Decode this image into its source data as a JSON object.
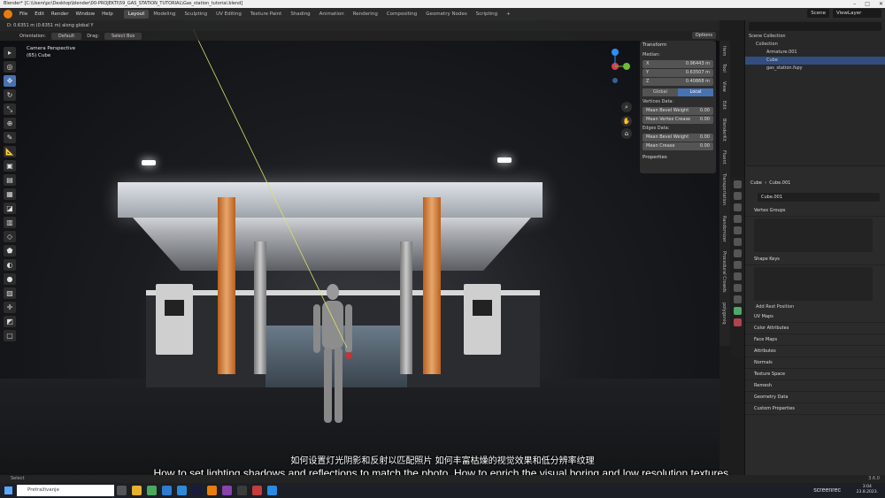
{
  "window": {
    "title": "Blender* [C:\\Users\\pc\\Desktop\\blender\\00-PROJEKTI\\59_GAS_STATION_TUTORIAL\\Gas_station_tutorial.blend]",
    "controls": [
      "–",
      "□",
      "✕"
    ]
  },
  "menu": [
    "File",
    "Edit",
    "Render",
    "Window",
    "Help"
  ],
  "workspaces": [
    "Layout",
    "Modeling",
    "Sculpting",
    "UV Editing",
    "Texture Paint",
    "Shading",
    "Animation",
    "Rendering",
    "Compositing",
    "Geometry Nodes",
    "Scripting",
    "+"
  ],
  "top_right": {
    "scene": "Scene",
    "view_layer": "ViewLayer"
  },
  "viewport": {
    "status": "D: 0.6351 m (0.6351 m) along global Y",
    "orientation_label": "Orientation:",
    "orientation_value": "Default",
    "drag_label": "Drag:",
    "drag_value": "Select Box",
    "options": "Options",
    "camera_label": "Camera Perspective",
    "object_label": "(65) Cube"
  },
  "npanel": {
    "title": "Transform",
    "median": "Median:",
    "x_label": "X",
    "x_value": "0.96443 m",
    "y_label": "Y",
    "y_value": "0.63507 m",
    "z_label": "Z",
    "z_value": "0.40868 m",
    "global": "Global",
    "local": "Local",
    "vertices_data": "Vertices Data:",
    "mean_bevel_weight": "Mean Bevel Weight",
    "mbw_value": "0.00",
    "mean_vertex_crease": "Mean Vertex Crease",
    "mvc_value": "0.00",
    "edges_data": "Edges Data:",
    "edge_bevel_weight": "Mean Bevel Weight",
    "ebw_value": "0.00",
    "mean_crease": "Mean Crease",
    "mc_value": "0.00",
    "properties": "Properties"
  },
  "vertical_tabs": [
    "Item",
    "Tool",
    "View",
    "Edit",
    "BlenderKit",
    "Fluent",
    "Transportation",
    "Randomizer",
    "Procedural Crowds",
    "polygoniq"
  ],
  "outliner": {
    "root": "Scene Collection",
    "collection": "Collection",
    "items": [
      "Armature.001",
      "Cube",
      "gas_station.fspy"
    ]
  },
  "properties": {
    "breadcrumb_obj": "Cube",
    "breadcrumb_mesh": "Cube.001",
    "mesh_name": "Cube.001",
    "sections": [
      "Vertex Groups",
      "Shape Keys"
    ],
    "add_rest_position": "Add Rest Position",
    "collapsed": [
      "UV Maps",
      "Color Attributes",
      "Face Maps",
      "Attributes",
      "Normals",
      "Texture Space",
      "Remesh",
      "Geometry Data",
      "Custom Properties"
    ]
  },
  "subtitles": {
    "cn": "如何设置灯光阴影和反射以匹配照片 如何丰富枯燥的视觉效果和低分辨率纹理",
    "en": "How to set lighting,shadows and reflections to match the photo, How to enrich the visual boring and low resolution textures,"
  },
  "statusbar": {
    "left": "Select",
    "version": "3.6.0"
  },
  "taskbar": {
    "search": "Pretraživanje",
    "time": "3:04",
    "date": "23.8.2023.",
    "watermark": "screenrec"
  },
  "colors": {
    "accent": "#4772b3",
    "orange_pillar": "#e7a66d",
    "selection": "#334d80"
  }
}
